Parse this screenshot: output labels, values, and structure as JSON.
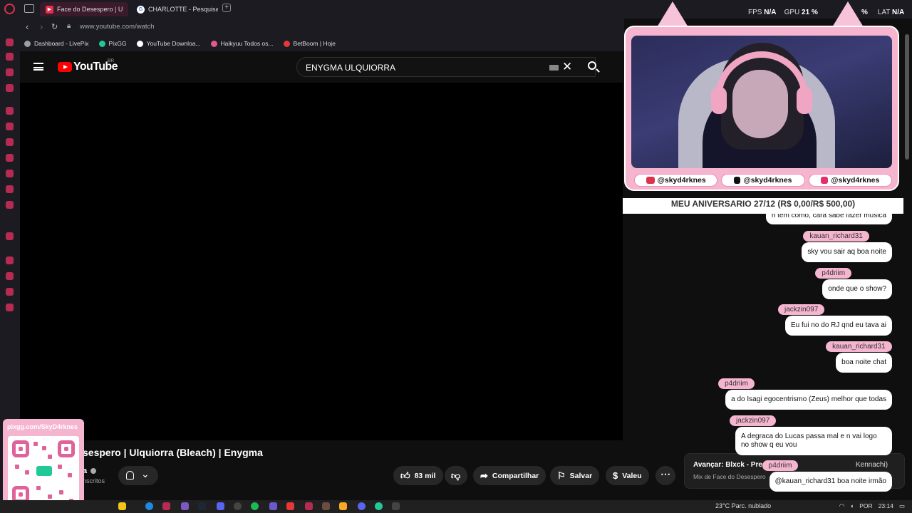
{
  "browser": {
    "tabs": [
      {
        "label": "Face do Desespero | U",
        "active": true
      },
      {
        "label": "CHARLOTTE - Pesquisa G",
        "active": false
      }
    ],
    "new_tab": "+",
    "url": "www.youtube.com/watch",
    "bookmarks": [
      {
        "label": "Dashboard - LivePix",
        "color": "#9aa0a6"
      },
      {
        "label": "PixGG",
        "color": "#20c997"
      },
      {
        "label": "YouTube Downloa...",
        "color": "#ffffff"
      },
      {
        "label": "Haikyuu Todos os...",
        "color": "#e05a8a"
      },
      {
        "label": "BetBoom | Hoje",
        "color": "#e53935"
      }
    ]
  },
  "youtube": {
    "logo_text": "YouTube",
    "country": "BR",
    "search_value": "ENYGMA ULQUIORRA",
    "video_title": "sespero | Ulquiorra (Bleach) | Enygma",
    "channel_name": "a",
    "channel_subs": "nscritos",
    "actions": {
      "likes": "83 mil",
      "share": "Compartilhar",
      "save": "Salvar",
      "thanks": "Valeu"
    },
    "up_next": {
      "title": "Avançar: Blxck - Pres",
      "title_tail": "Kennachi)",
      "subtitle": "Mix de Face do Desespero"
    }
  },
  "overlay": {
    "hud": {
      "fps_label": "FPS",
      "fps": "N/A",
      "gpu_label": "GPU",
      "gpu": "21 %",
      "pct": "%",
      "lat_label": "LAT",
      "lat": "N/A"
    },
    "socials": [
      {
        "icon": "youtube-icon",
        "handle": "@skyd4rknes",
        "color": "#e0314b"
      },
      {
        "icon": "tiktok-icon",
        "handle": "@skyd4rknes",
        "color": "#111111"
      },
      {
        "icon": "instagram-icon",
        "handle": "@skyd4rknes",
        "color": "#e1306c"
      }
    ],
    "goal": "MEU ANIVERSARIO 27/12 (R$ 0,00/R$ 500,00)",
    "qr_label": "pixgg.com/SkyD4rknes"
  },
  "chat": [
    {
      "user": "",
      "text": "n tem como, cara sabe fazer musica"
    },
    {
      "user": "kauan_richard31",
      "text": "sky vou sair aq boa noite"
    },
    {
      "user": "p4driim",
      "text": "onde que o show?"
    },
    {
      "user": "jackzin097",
      "text": "Eu fui no do RJ qnd eu tava ai"
    },
    {
      "user": "kauan_richard31",
      "text": "boa noite chat"
    },
    {
      "user": "p4driim",
      "text": "a do Isagi egocentrismo (Zeus) melhor que todas"
    },
    {
      "user": "jackzin097",
      "text": "A degraca do Lucas passa mal e n vai logo no show q eu vou"
    },
    {
      "user": "p4driim",
      "text": "@kauan_richard31 boa noite irmão"
    }
  ],
  "taskbar": {
    "weather": "23°C  Parc. nublado",
    "lang": "POR",
    "time": "23:14"
  }
}
